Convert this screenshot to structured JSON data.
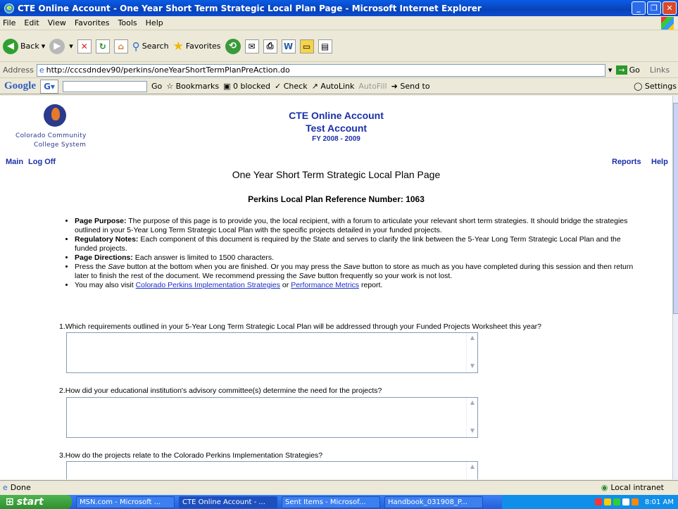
{
  "window": {
    "title": "CTE Online Account - One Year Short Term Strategic Local Plan Page - Microsoft Internet Explorer"
  },
  "menu": [
    "File",
    "Edit",
    "View",
    "Favorites",
    "Tools",
    "Help"
  ],
  "toolbar": {
    "back": "Back",
    "search": "Search",
    "favorites": "Favorites"
  },
  "address": {
    "label": "Address",
    "url": "http://cccsdndev90/perkins/oneYearShortTermPlanPreAction.do",
    "go": "Go",
    "links": "Links"
  },
  "google_bar": {
    "logo": "Google",
    "go": "Go",
    "bookmarks": "Bookmarks",
    "blocked": "0 blocked",
    "check": "Check",
    "autolink": "AutoLink",
    "autofill": "AutoFill",
    "sendto": "Send to",
    "settings": "Settings"
  },
  "page": {
    "logo_line1": "Colorado Community",
    "logo_line2": "College System",
    "header_title": "CTE Online Account",
    "header_account": "Test Account",
    "header_fy": "FY 2008 - 2009",
    "nav_main": "Main",
    "nav_logoff": "Log Off",
    "nav_reports": "Reports",
    "nav_help": "Help",
    "title": "One Year Short Term Strategic Local Plan Page",
    "ref_number": "Perkins Local Plan Reference Number: 1063",
    "bullets": {
      "purpose_label": "Page Purpose:",
      "purpose_text": " The purpose of this page is to provide you, the local recipient, with a forum to articulate your relevant short term strategies. It should bridge the strategies outlined in your 5-Year Long Term Strategic Local Plan with the specific projects detailed in your funded projects.",
      "regulatory_label": "Regulatory Notes:",
      "regulatory_text": " Each component of this document is required by the State and serves to clarify the link between the 5-Year Long Term Strategic Local Plan and the funded projects.",
      "directions_label": "Page Directions:",
      "directions_text": " Each answer is limited to 1500 characters.",
      "save_text_1": "Press the ",
      "save_word": "Save",
      "save_text_2": " button at the bottom when you are finished. Or you may press the ",
      "save_text_3": " button to store as much as you have completed during this session and then return later to finish the rest of the document. We recommend pressing the ",
      "save_text_4": " button frequently so your work is not lost.",
      "visit_text": "You may also visit ",
      "link_strategies": "Colorado Perkins Implementation Strategies",
      "or_text": " or ",
      "link_metrics": "Performance Metrics",
      "report_text": " report."
    },
    "questions": [
      "1.Which requirements outlined in your 5-Year Long Term Strategic Local Plan will be addressed through your Funded Projects Worksheet this year?",
      "2.How did your educational institution's advisory committee(s) determine the need for the projects?",
      "3.How do the projects relate to the Colorado Perkins Implementation Strategies?"
    ]
  },
  "status": {
    "done": "Done",
    "zone": "Local intranet"
  },
  "taskbar": {
    "start": "start",
    "tasks": [
      "MSN.com - Microsoft ...",
      "CTE Online Account - ...",
      "Sent Items - Microsof...",
      "Handbook_031908_P..."
    ],
    "time": "8:01 AM"
  }
}
